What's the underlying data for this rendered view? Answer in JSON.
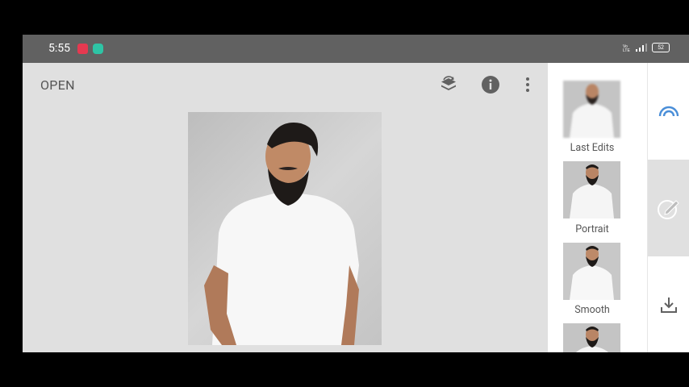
{
  "status_bar": {
    "time": "5:55",
    "battery": "52",
    "network": "Vo LTE"
  },
  "toolbar": {
    "open_label": "OPEN"
  },
  "looks": [
    {
      "label": "Last Edits"
    },
    {
      "label": "Portrait"
    },
    {
      "label": "Smooth"
    }
  ],
  "colors": {
    "accent": "#4a8ed8",
    "background": "#e0e0e0",
    "status_bar": "#616161"
  }
}
